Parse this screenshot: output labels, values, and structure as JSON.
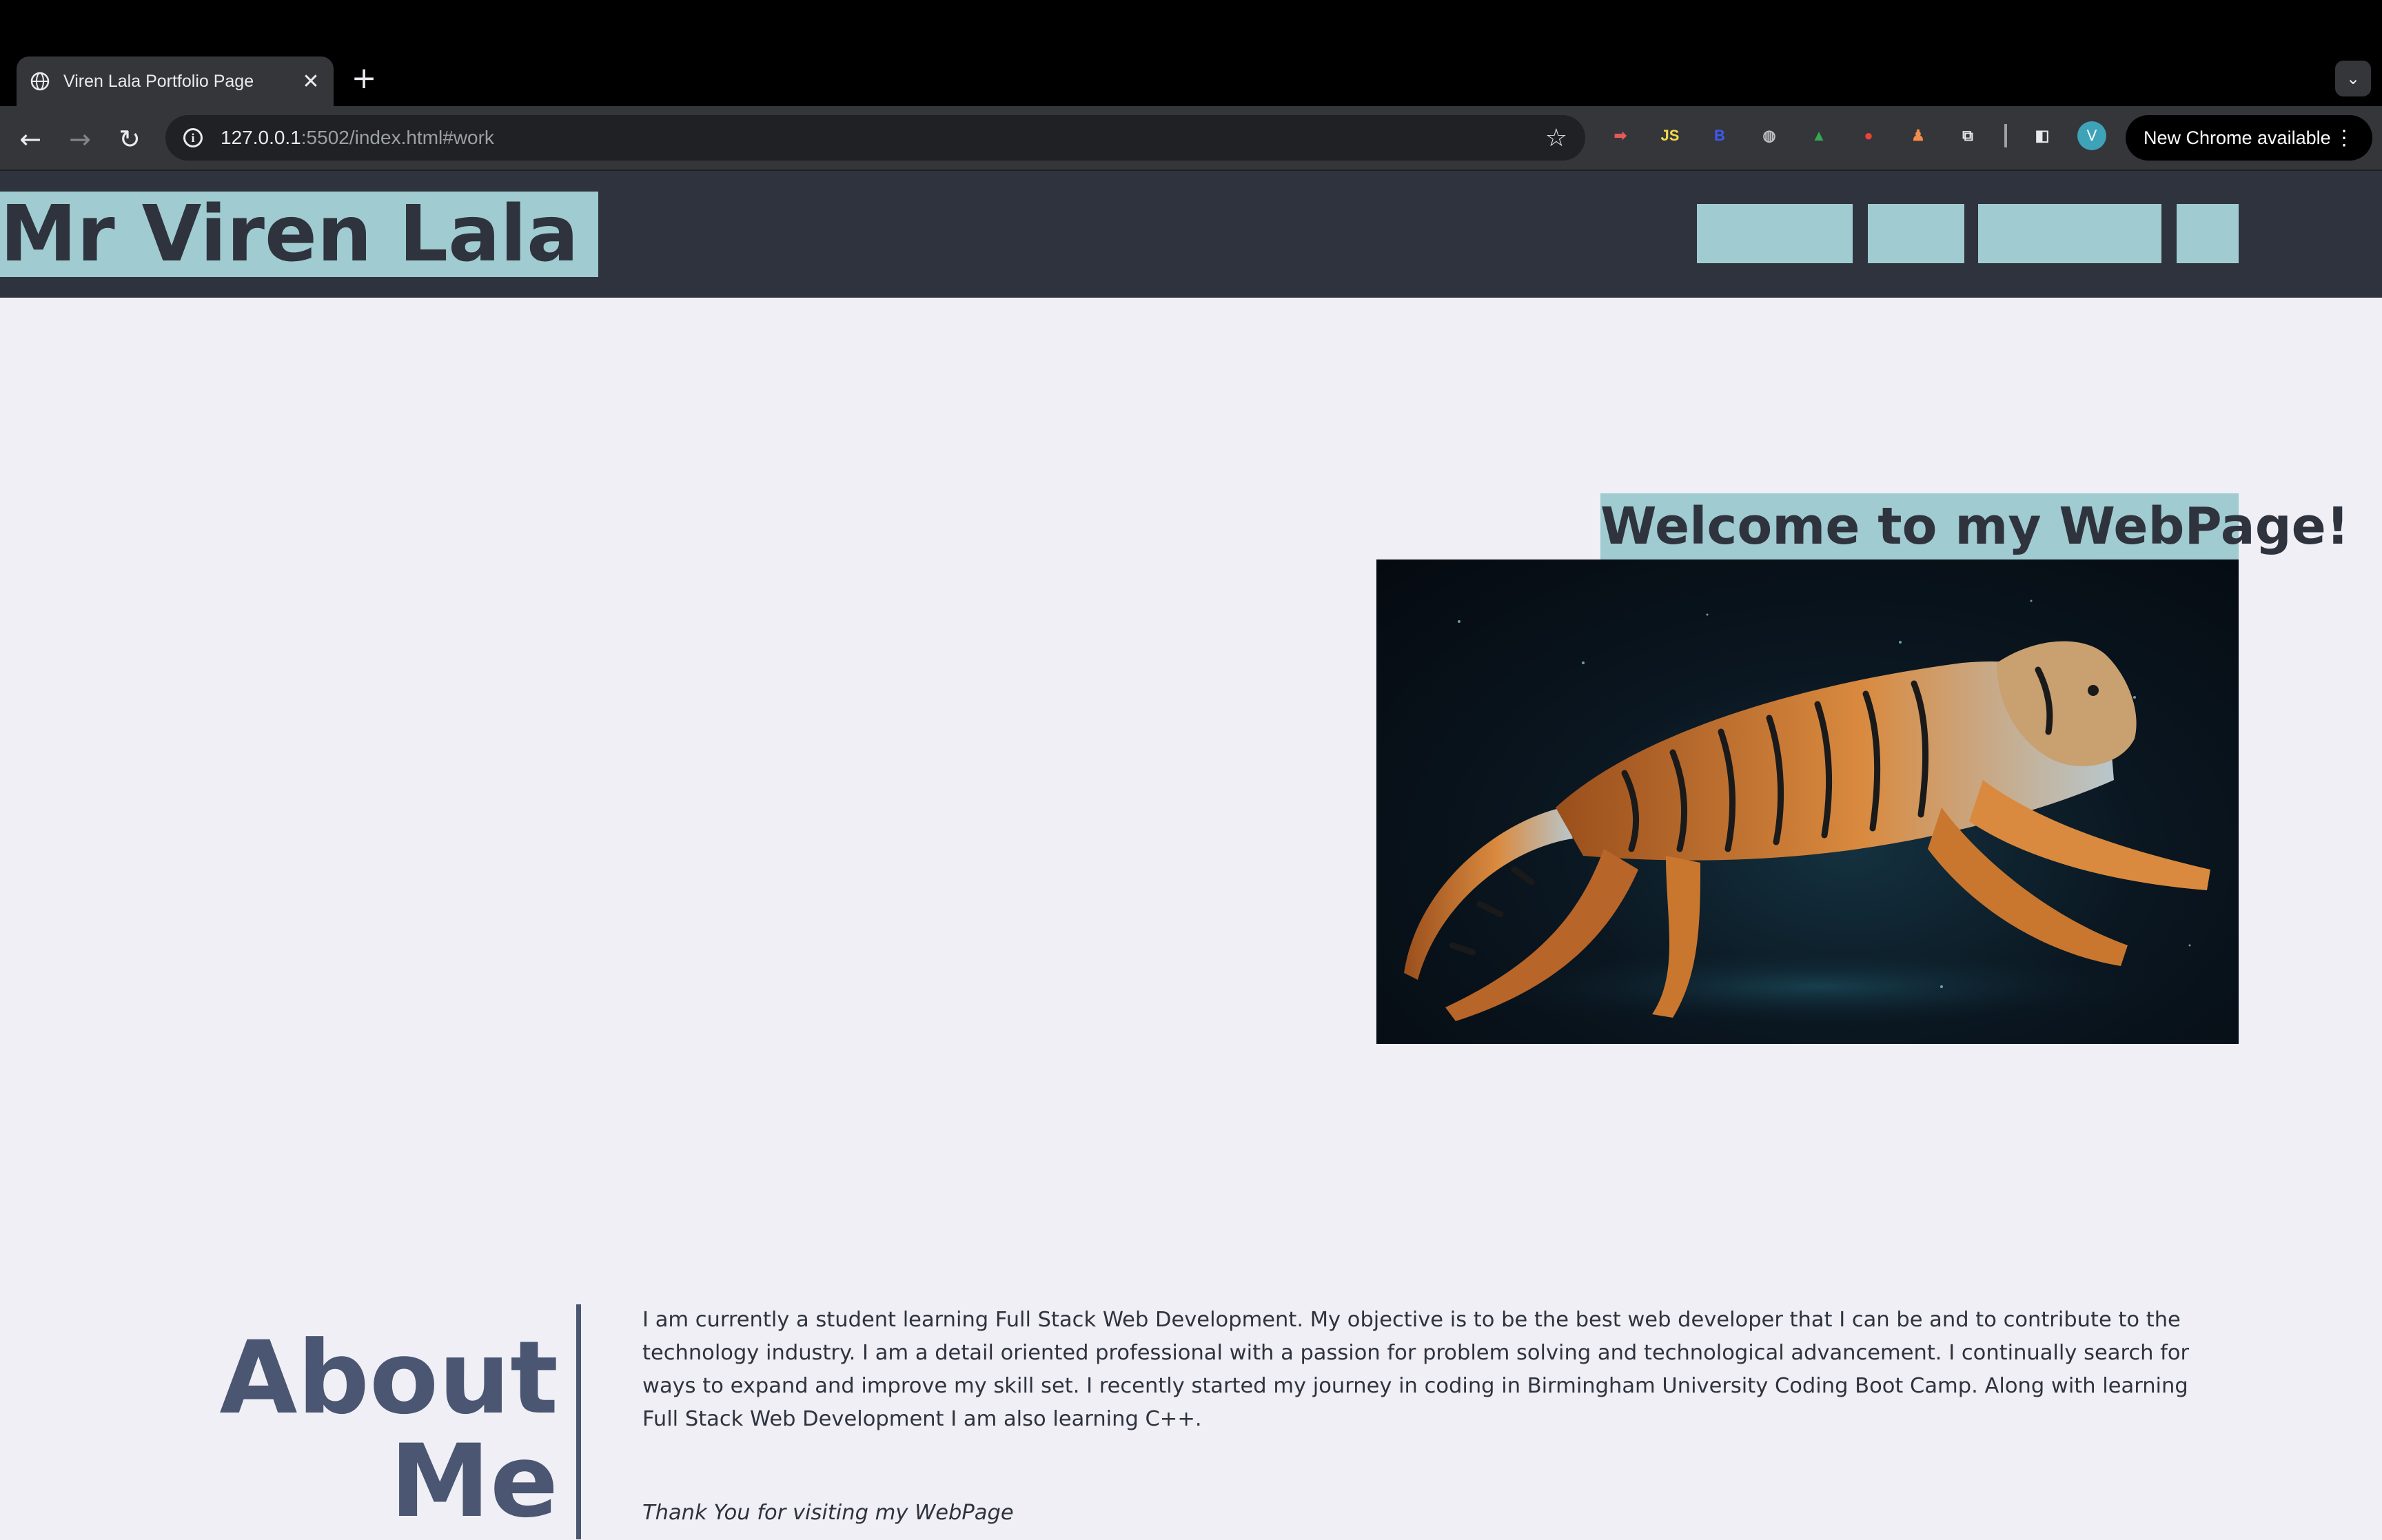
{
  "browser": {
    "tab_title": "Viren Lala Portfolio Page",
    "tab_close_glyph": "✕",
    "new_tab_glyph": "+",
    "tab_search_glyph": "⌄",
    "url_host": "127.0.0.1",
    "url_rest": ":5502/index.html#work",
    "update_label": "New Chrome available",
    "profile_initial": "V",
    "menu_glyph": "⋮",
    "back_glyph": "←",
    "forward_glyph": "→",
    "reload_glyph": "↻",
    "star_glyph": "☆",
    "extensions": [
      {
        "icon": "red-arrow-extension-icon",
        "glyph": "➡",
        "color": "#e45a5a"
      },
      {
        "icon": "js-extension-icon",
        "glyph": "JS",
        "color": "#f2d94e"
      },
      {
        "icon": "blue-extension-icon",
        "glyph": "B",
        "color": "#3d5af1"
      },
      {
        "icon": "globe-extension-icon",
        "glyph": "◍",
        "color": "#bdc1c6"
      },
      {
        "icon": "google-drive-icon",
        "glyph": "▲",
        "color": "#34a853"
      },
      {
        "icon": "red-shield-extension-icon",
        "glyph": "●",
        "color": "#ea4335"
      },
      {
        "icon": "orange-extension-icon",
        "glyph": "♟",
        "color": "#f28b4b"
      },
      {
        "icon": "puzzle-extensions-icon",
        "glyph": "⧉",
        "color": "#e8eaed"
      },
      {
        "icon": "side-panel-icon",
        "glyph": "◧",
        "color": "#e8eaed"
      }
    ]
  },
  "header": {
    "site_name": "Mr Viren Lala",
    "nav_links": [
      "",
      "",
      "",
      ""
    ]
  },
  "hero": {
    "heading": "Welcome to my WebPage!",
    "image_alt": "tiger-illustration"
  },
  "about": {
    "heading": "About Me",
    "body": "I am currently a student learning Full Stack Web Development. My objective is to be the best web developer that I can be and to contribute to the technology industry. I am a detail oriented professional with a passion for problem solving and technological advancement. I continually search for ways to expand and improve my skill set. I recently started my journey in coding in Birmingham University Coding Boot Camp. Along with learning Full Stack Web Development I am also learning C++.",
    "thanks": "Thank You for visiting my WebPage"
  },
  "colors": {
    "header_bg": "#2f333d",
    "accent": "#9fcbd1",
    "page_bg": "#efeff5",
    "heading_text": "#4a5672"
  }
}
